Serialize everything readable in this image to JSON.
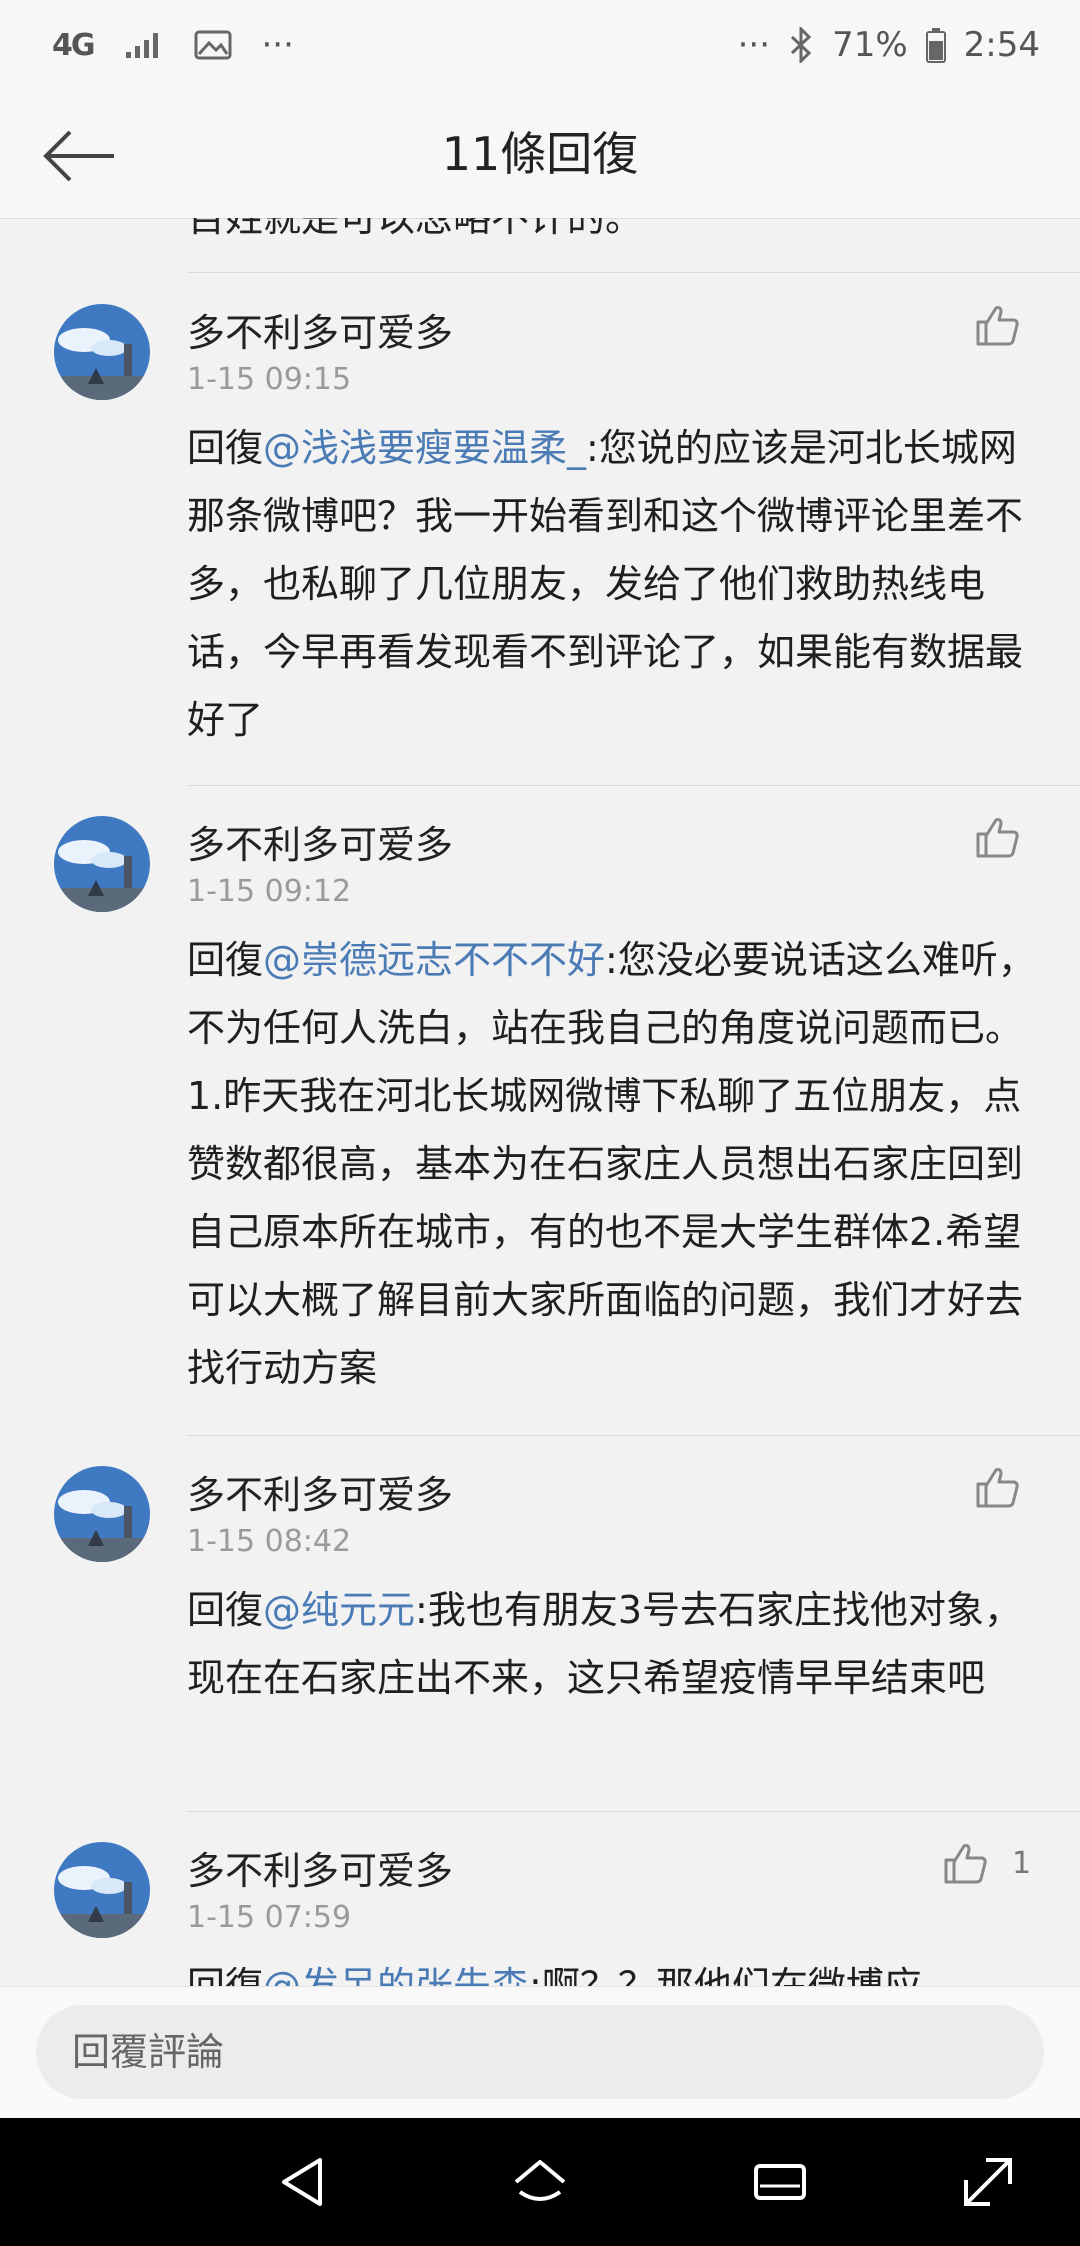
{
  "status_bar": {
    "network": "4G",
    "more_left": "···",
    "more_right": "···",
    "battery": "71%",
    "time": "2:54"
  },
  "header": {
    "title": "11條回復"
  },
  "partial_top_text": "百姓就是可以忽略不计的。",
  "comments": [
    {
      "username": "多不利多可爱多",
      "time": "1-15 09:15",
      "reply_prefix": "回復",
      "mention": "@浅浅要瘦要温柔_",
      "text": ":您说的应该是河北长城网那条微博吧？我一开始看到和这个微博评论里差不多，也私聊了几位朋友，发给了他们救助热线电话，今早再看发现看不到评论了，如果能有数据最好了",
      "likes": ""
    },
    {
      "username": "多不利多可爱多",
      "time": "1-15 09:12",
      "reply_prefix": "回復",
      "mention": "@崇德远志不不不好",
      "text": ":您没必要说话这么难听，不为任何人洗白，站在我自己的角度说问题而已。1.昨天我在河北长城网微博下私聊了五位朋友，点赞数都很高，基本为在石家庄人员想出石家庄回到自己原本所在城市，有的也不是大学生群体2.希望可以大概了解目前大家所面临的问题，我们才好去找行动方案",
      "likes": ""
    },
    {
      "username": "多不利多可爱多",
      "time": "1-15 08:42",
      "reply_prefix": "回復",
      "mention": "@纯元元",
      "text": ":我也有朋友3号去石家庄找他对象，现在在石家庄出不来，这只希望疫情早早结束吧",
      "likes": ""
    },
    {
      "username": "多不利多可爱多",
      "time": "1-15 07:59",
      "reply_prefix": "回復",
      "mention": "@发呆的张先森",
      "text": ":啊？？那他们在微博应",
      "likes": "1"
    }
  ],
  "reply_bar": {
    "placeholder": "回覆評論"
  },
  "icons": {
    "back": "arrow-left-icon",
    "like": "thumbs-up-icon",
    "nav_back": "triangle-back-icon",
    "nav_home": "home-icon",
    "nav_recents": "recents-icon",
    "nav_expand": "expand-icon"
  }
}
